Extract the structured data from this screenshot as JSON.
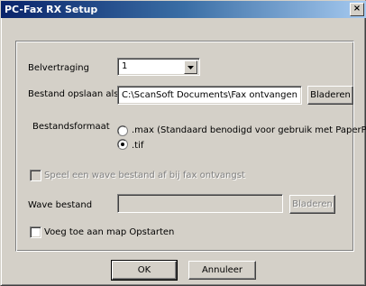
{
  "window": {
    "title": "PC-Fax RX Setup",
    "close_glyph": "×"
  },
  "delay": {
    "label": "Belvertraging",
    "value": "1"
  },
  "save": {
    "label": "Bestand opslaan als",
    "path": "C:\\ScanSoft Documents\\Fax ontvangen",
    "browse_label": "Bladeren"
  },
  "format": {
    "label": "Bestandsformaat",
    "options": [
      {
        "label": ".max (Standaard benodigd voor gebruik met PaperPort)",
        "selected": false
      },
      {
        "label": ".tif",
        "selected": true
      }
    ]
  },
  "wave": {
    "play_label": "Speel een wave bestand af bij fax ontvangst",
    "play_checked": false,
    "play_enabled": false,
    "file_label": "Wave bestand",
    "file_value": "",
    "browse_label": "Bladeren"
  },
  "startup": {
    "label": "Voeg toe aan map Opstarten",
    "checked": false
  },
  "buttons": {
    "ok": "OK",
    "cancel": "Annuleer"
  },
  "colors": {
    "face": "#d4d0c8",
    "title_start": "#0a246a",
    "title_end": "#a6caf0",
    "disabled_text": "#808080"
  }
}
